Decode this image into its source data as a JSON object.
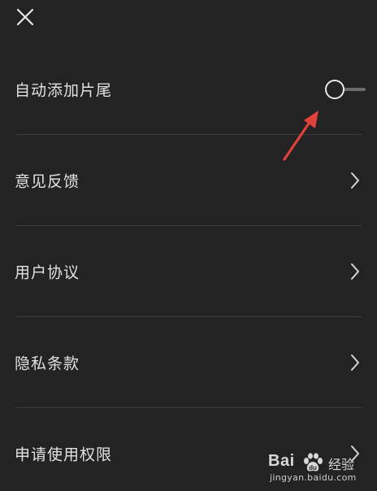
{
  "header": {
    "close_icon": "close-icon"
  },
  "settings": {
    "items": [
      {
        "label": "自动添加片尾",
        "control": "toggle",
        "state": "off"
      },
      {
        "label": "意见反馈",
        "control": "chevron"
      },
      {
        "label": "用户协议",
        "control": "chevron"
      },
      {
        "label": "隐私条款",
        "control": "chevron"
      },
      {
        "label": "申请使用权限",
        "control": "chevron"
      }
    ]
  },
  "watermark": {
    "brand": "Bai",
    "suffix": "经验",
    "domain": "jingyan.baidu.com"
  },
  "colors": {
    "background": "#232323",
    "text": "#e2e2e2",
    "divider": "#3c3c3c",
    "annotation_arrow": "#e0413a"
  }
}
